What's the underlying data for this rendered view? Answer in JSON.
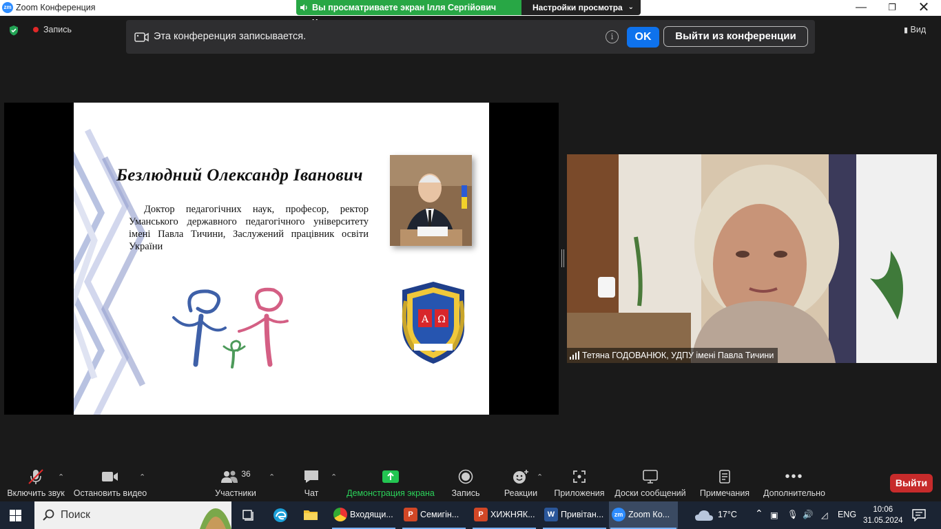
{
  "window": {
    "title": "Zoom Конференция",
    "share_notice": "Вы просматриваете экран Ілля Сергійович Хомов",
    "view_settings": "Настройки просмотра"
  },
  "top_status": {
    "recording_label": "Запись",
    "view_label": "Вид"
  },
  "notification": {
    "message": "Эта конференция записывается.",
    "info_glyph": "i",
    "ok_label": "OK",
    "leave_label": "Выйти из конференции"
  },
  "slide": {
    "name": "Безлюдний Олександр Іванович",
    "description": "Доктор педагогічних наук, професор, ректор Уманського державного педагогічного університету імені Павла Тичини, Заслужений працівник освіти України"
  },
  "participant": {
    "name": "Тетяна ГОДОВАНЮК, УДПУ імені Павла Тичини"
  },
  "toolbar": {
    "unmute": "Включить звук",
    "stop_video": "Остановить видео",
    "participants": "Участники",
    "participants_count": "36",
    "chat": "Чат",
    "share_screen": "Демонстрация экрана",
    "record": "Запись",
    "reactions": "Реакции",
    "apps": "Приложения",
    "whiteboards": "Доски сообщений",
    "notes": "Примечания",
    "more": "Дополнительно",
    "leave": "Выйти"
  },
  "taskbar": {
    "search_placeholder": "Поиск",
    "tasks": [
      {
        "label": "Входящи...",
        "icon": "chrome-icon"
      },
      {
        "label": "Семигін...",
        "icon": "powerpoint-icon"
      },
      {
        "label": "ХИЖНЯК...",
        "icon": "powerpoint-icon"
      },
      {
        "label": "Привітан...",
        "icon": "word-icon"
      },
      {
        "label": "Zoom Ко...",
        "icon": "zoom-icon"
      }
    ],
    "weather": "17°C",
    "language": "ENG",
    "time": "10:06",
    "date": "31.05.2024"
  },
  "colors": {
    "share_green": "#28a745",
    "ok_blue": "#0e72ed",
    "leave_red": "#c72b2b",
    "zoom_blue": "#2d8cff",
    "taskbar": "#1b2433"
  }
}
